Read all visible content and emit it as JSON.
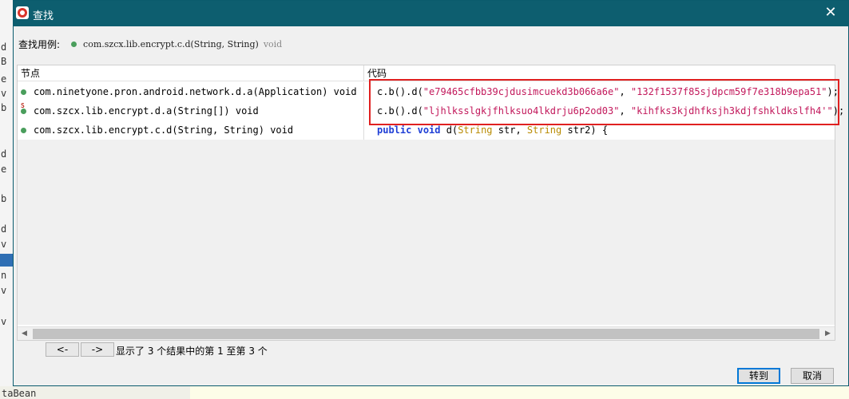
{
  "dialog": {
    "title": "查找",
    "example_label": "查找用例:",
    "example_signature": "com.szcx.lib.encrypt.c.d(String, String)",
    "example_return": "void"
  },
  "table": {
    "headers": {
      "nodes": "节点",
      "code": "代码"
    },
    "rows": [
      {
        "node": "com.ninetyone.pron.android.network.d.a(Application) void",
        "code_prefix": "c.b().d(",
        "code_arg1": "\"e79465cfbb39cjdusimcuekd3b066a6e\"",
        "code_sep": ", ",
        "code_arg2": "\"132f1537f85sjdpcm59f7e318b9epa51\"",
        "code_suffix": ");"
      },
      {
        "node": "com.szcx.lib.encrypt.d.a(String[]) void",
        "node_mark": "S",
        "code_prefix": "c.b().d(",
        "code_arg1": "\"ljhlksslgkjfhlksuo4lkdrju6p2od03\"",
        "code_sep": ", ",
        "code_arg2": "\"kihfks3kjdhfksjh3kdjfshkldkslfh4'\"",
        "code_suffix": ");"
      },
      {
        "node": "com.szcx.lib.encrypt.c.d(String, String) void",
        "code_kw1": "public",
        "code_kw2": "void",
        "code_name": "d(",
        "code_t1": "String",
        "code_p1": " str, ",
        "code_t2": "String",
        "code_p2": " str2) {"
      }
    ]
  },
  "pager": {
    "prev_label": "<-",
    "next_label": "->",
    "status": "显示了 3 个结果中的第 1 至第 3 个"
  },
  "buttons": {
    "goto": "转到",
    "cancel": "取消"
  },
  "background": {
    "left_letters": [
      "d",
      "B",
      "e",
      "v",
      "b",
      "d",
      "e",
      "b",
      "d",
      "v",
      "n",
      "v",
      "v"
    ],
    "bottom_text": "taBean"
  },
  "colors": {
    "titlebar": "#0d5e6f",
    "string_literal": "#c2185b",
    "keyword": "#1f3fd6",
    "type": "#b88a00",
    "highlight_border": "#e02020",
    "node_dot": "#4a9e5c"
  },
  "icons": {
    "app": "app-logo-icon",
    "close": "close-icon",
    "node": "green-dot-icon"
  }
}
